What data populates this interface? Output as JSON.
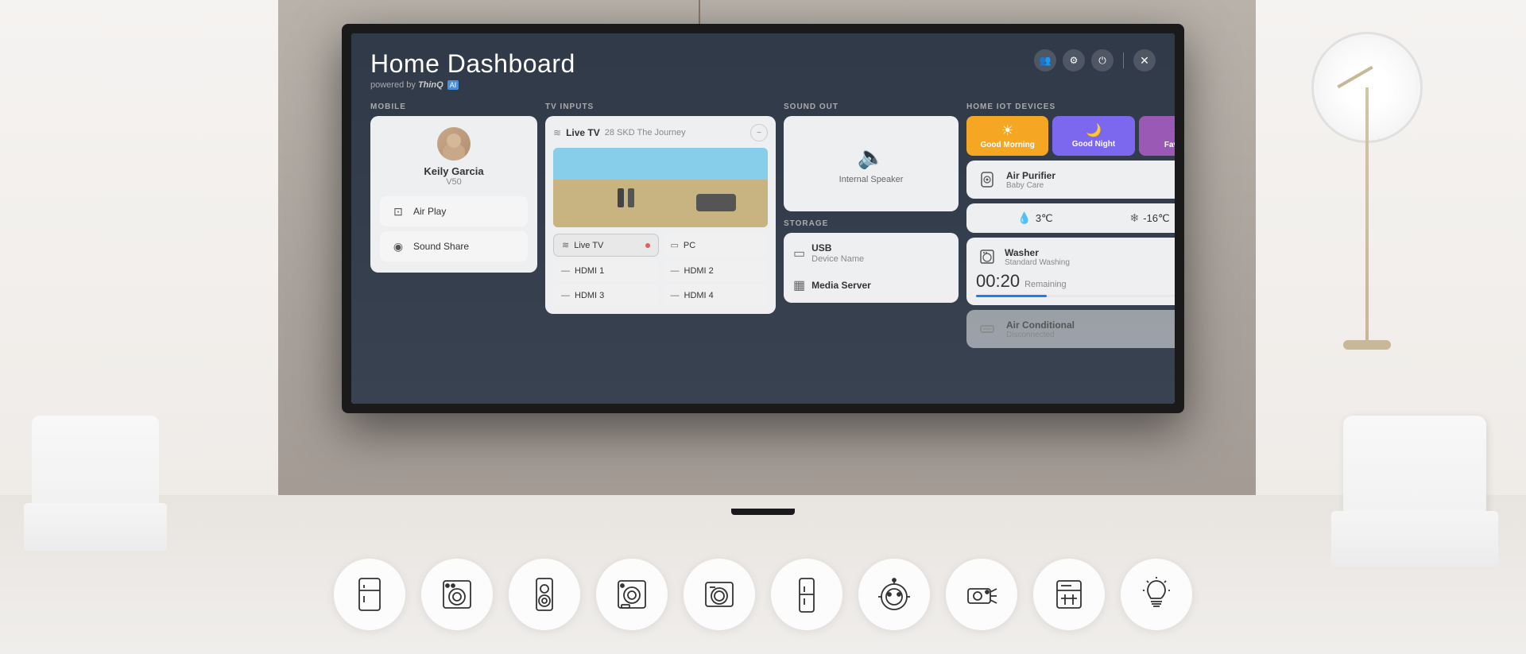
{
  "room": {
    "bg_color": "#b0a89e"
  },
  "dashboard": {
    "title": "Home Dashboard",
    "powered_by": "powered by",
    "brand": "ThinQ",
    "brand_suffix": "AI",
    "controls": {
      "people_icon": "👥",
      "settings_icon": "⚙",
      "power_icon": "⏻",
      "close_icon": "✕"
    }
  },
  "sections": {
    "mobile": {
      "label": "MOBILE",
      "user": {
        "name": "Keily Garcia",
        "device": "V50"
      },
      "buttons": [
        {
          "icon": "□→",
          "label": "Air Play"
        },
        {
          "icon": "◉",
          "label": "Sound Share"
        }
      ]
    },
    "tv_inputs": {
      "label": "TV INPUTS",
      "current": {
        "name": "Live TV",
        "channel": "28 SKD The Journey"
      },
      "buttons": [
        {
          "icon": "≋",
          "label": "Live TV",
          "active": true,
          "dot": true
        },
        {
          "icon": "▭",
          "label": "PC",
          "active": false,
          "dot": false
        },
        {
          "icon": "—",
          "label": "HDMI 1",
          "active": false,
          "dot": false
        },
        {
          "icon": "—",
          "label": "HDMI 2",
          "active": false,
          "dot": false
        },
        {
          "icon": "—",
          "label": "HDMI 3",
          "active": false,
          "dot": false
        },
        {
          "icon": "—",
          "label": "HDMI 4",
          "active": false,
          "dot": false
        }
      ]
    },
    "sound_out": {
      "label": "SOUND OUT",
      "current": "Internal Speaker"
    },
    "storage": {
      "label": "STORAGE",
      "items": [
        {
          "icon": "▭",
          "name": "USB",
          "sub": "Device Name"
        },
        {
          "icon": "▦",
          "name": "Media Server",
          "sub": ""
        }
      ]
    },
    "home_iot": {
      "label": "HOME IOT DEVICES",
      "modes": [
        {
          "icon": "☀",
          "label": "Good Morning",
          "color": "morning"
        },
        {
          "icon": "🌙",
          "label": "Good Night",
          "color": "night"
        },
        {
          "icon": "★",
          "label": "Favorite",
          "color": "favorite"
        }
      ],
      "devices": [
        {
          "icon": "💨",
          "name": "Air Purifier",
          "sub": "Baby Care",
          "power": true,
          "power_color": "blue"
        },
        {
          "icon": "❄",
          "name": "",
          "sub": "",
          "temps": [
            {
              "icon": "💧",
              "value": "3℃"
            },
            {
              "icon": "❄",
              "value": "-16℃"
            }
          ]
        },
        {
          "icon": "🌀",
          "name": "Washer",
          "sub": "Standard Washing",
          "time": "00:20",
          "remaining": "Remaining",
          "progress": 30
        },
        {
          "icon": "❄",
          "name": "Air Conditional",
          "sub": "Disconnected",
          "power": false,
          "power_color": "off"
        }
      ]
    }
  },
  "bottom_icons": [
    {
      "name": "refrigerator-icon",
      "label": "Refrigerator"
    },
    {
      "name": "washer-icon",
      "label": "Washer"
    },
    {
      "name": "tower-speaker-icon",
      "label": "Tower Speaker"
    },
    {
      "name": "dryer-icon",
      "label": "Dryer"
    },
    {
      "name": "washing-machine-icon",
      "label": "Washing Machine"
    },
    {
      "name": "tall-fridge-icon",
      "label": "Tall Fridge"
    },
    {
      "name": "robot-icon",
      "label": "Robot"
    },
    {
      "name": "projector-icon",
      "label": "Projector"
    },
    {
      "name": "dishwasher-icon",
      "label": "Dishwasher"
    },
    {
      "name": "lightbulb-icon",
      "label": "Light Bulb"
    }
  ]
}
